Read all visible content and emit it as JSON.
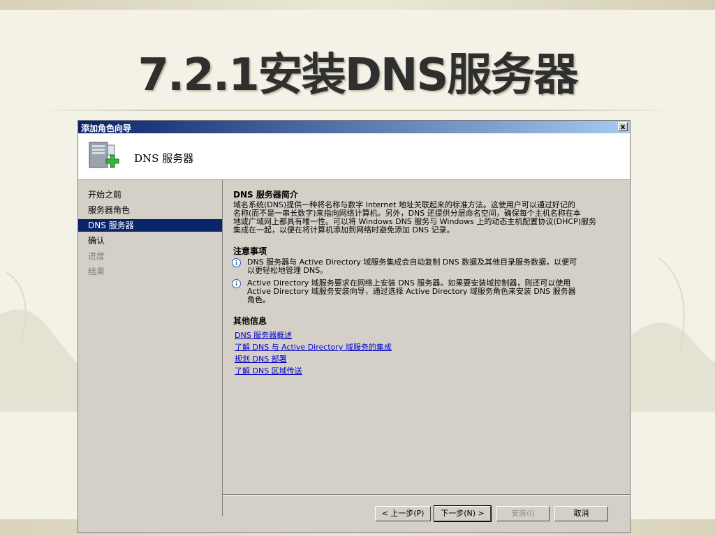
{
  "slide": {
    "title": "7.2.1安装DNS服务器"
  },
  "window": {
    "title": "添加角色向导",
    "close_glyph": "x",
    "header_title": "DNS 服务器"
  },
  "nav": {
    "items": [
      {
        "label": "开始之前",
        "state": "normal"
      },
      {
        "label": "服务器角色",
        "state": "normal"
      },
      {
        "label": "DNS 服务器",
        "state": "selected"
      },
      {
        "label": "确认",
        "state": "normal"
      },
      {
        "label": "进度",
        "state": "disabled"
      },
      {
        "label": "结果",
        "state": "disabled"
      }
    ]
  },
  "content": {
    "intro_heading": "DNS 服务器简介",
    "intro_lines": [
      "域名系统(DNS)提供一种将名称与数字 Internet 地址关联起来的标准方法。这使用户可以通过好记的",
      "名称(而不是一串长数字)来指向网络计算机。另外，DNS 还提供分层命名空间，确保每个主机名称在本",
      "地或广域网上都具有唯一性。可以将 Windows DNS 服务与 Windows 上的动态主机配置协议(DHCP)服务",
      "集成在一起，以便在将计算机添加到网络时避免添加 DNS 记录。"
    ],
    "notes_heading": "注意事项",
    "notes": [
      {
        "icon": "info-icon",
        "lines": [
          "DNS 服务器与 Active Directory 域服务集成会自动复制 DNS 数据及其他目录服务数据，以便可",
          "以更轻松地管理 DNS。"
        ]
      },
      {
        "icon": "info-icon",
        "lines": [
          "Active Directory 域服务要求在网络上安装 DNS 服务器。如果要安装域控制器，则还可以使用",
          "Active Directory 域服务安装向导，通过选择 Active Directory 域服务角色来安装 DNS 服务器",
          "角色。"
        ]
      }
    ],
    "more_heading": "其他信息",
    "links": [
      "DNS 服务器概述",
      "了解 DNS 与 Active Directory 域服务的集成",
      "规划 DNS 部署",
      "了解 DNS 区域传送"
    ]
  },
  "buttons": {
    "prev": "< 上一步(P)",
    "next": "下一步(N) >",
    "install": "安装(I)",
    "cancel": "取消"
  },
  "colors": {
    "titlebar_start": "#0a246a",
    "titlebar_end": "#a6caf0",
    "selection": "#0a246a",
    "link": "#0000cc",
    "dialog_face": "#d4d0c8"
  }
}
